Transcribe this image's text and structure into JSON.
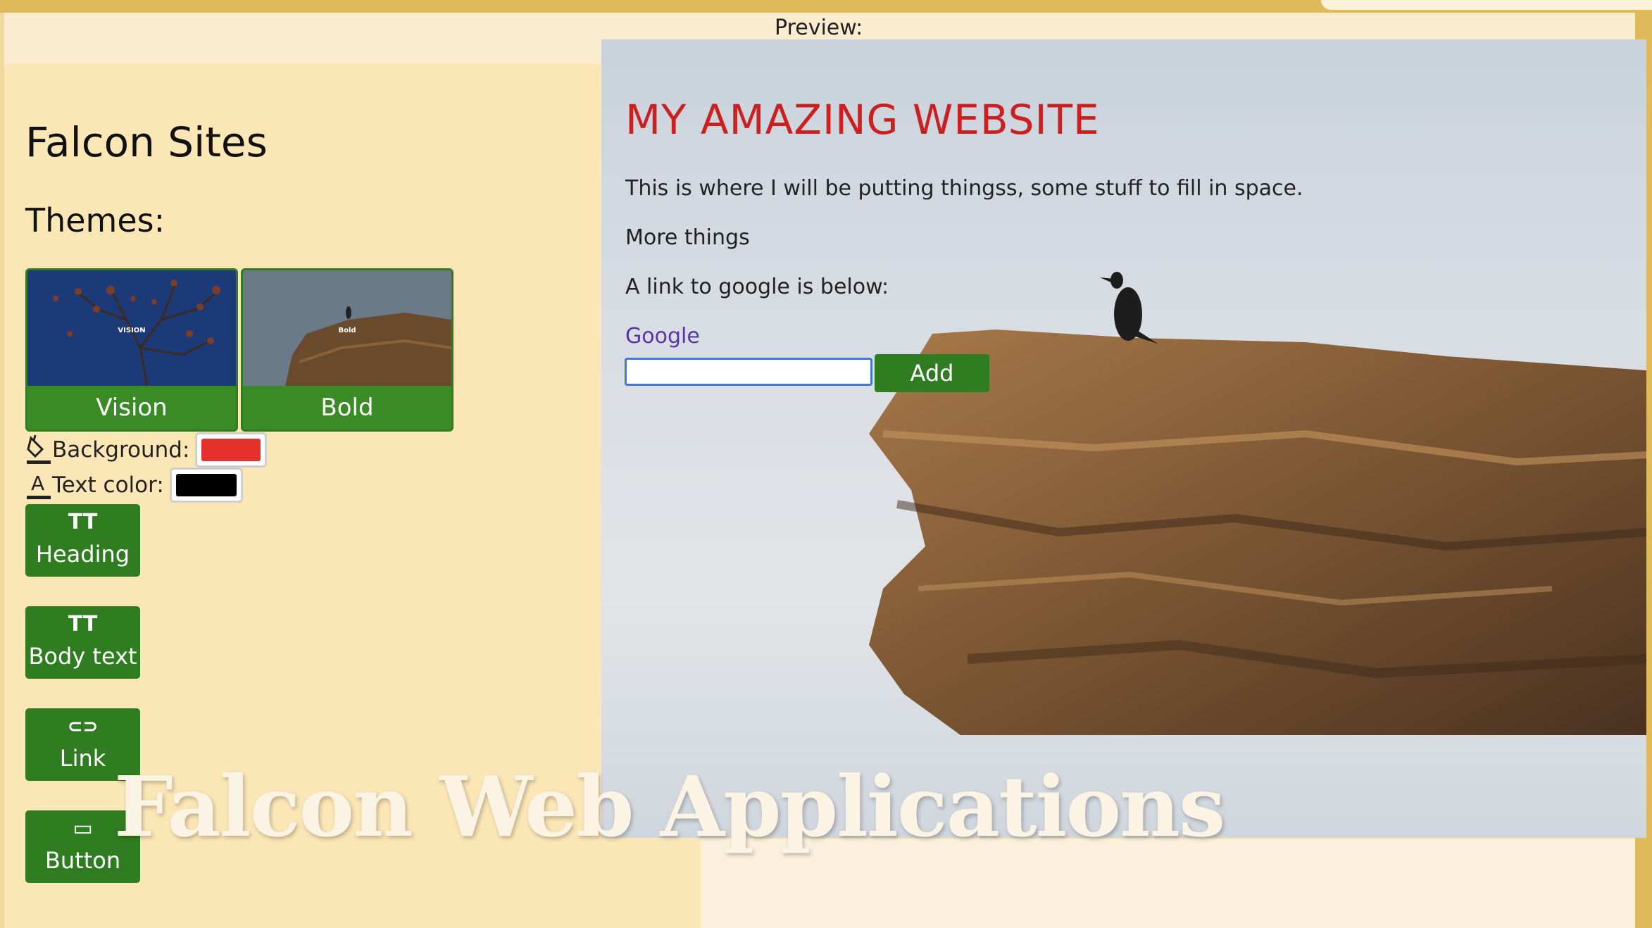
{
  "preview": {
    "label": "Preview:"
  },
  "sidebar": {
    "app_title": "Falcon Sites",
    "themes_label": "Themes:",
    "themes": [
      {
        "name": "Vision",
        "thumb_text": "VISION"
      },
      {
        "name": "Bold",
        "thumb_text": "Bold"
      }
    ],
    "background": {
      "label": "Background:",
      "value": "#e5312b"
    },
    "text_color": {
      "label": "Text color:",
      "value": "#000000"
    },
    "tools": [
      {
        "icon": "text-size-icon",
        "glyph": "TT",
        "label": "Heading"
      },
      {
        "icon": "text-size-icon",
        "glyph": "TT",
        "label": "Body text"
      },
      {
        "icon": "link-plus-icon",
        "glyph": "⊂⊃",
        "label": "Link"
      },
      {
        "icon": "button-icon",
        "glyph": "▭",
        "label": "Button"
      }
    ]
  },
  "site": {
    "heading": "MY AMAZING WEBSITE",
    "paragraphs": [
      "This is where I will be putting thingss, some stuff to fill in space.",
      "More things",
      "A link to google is below:"
    ],
    "link_text": "Google",
    "input_value": "",
    "add_label": "Add"
  },
  "watermark": "Falcon Web Applications",
  "colors": {
    "accent_green": "#2f7d20",
    "heading_red": "#cc1f1f",
    "panel_bg": "#fbe6b6"
  }
}
